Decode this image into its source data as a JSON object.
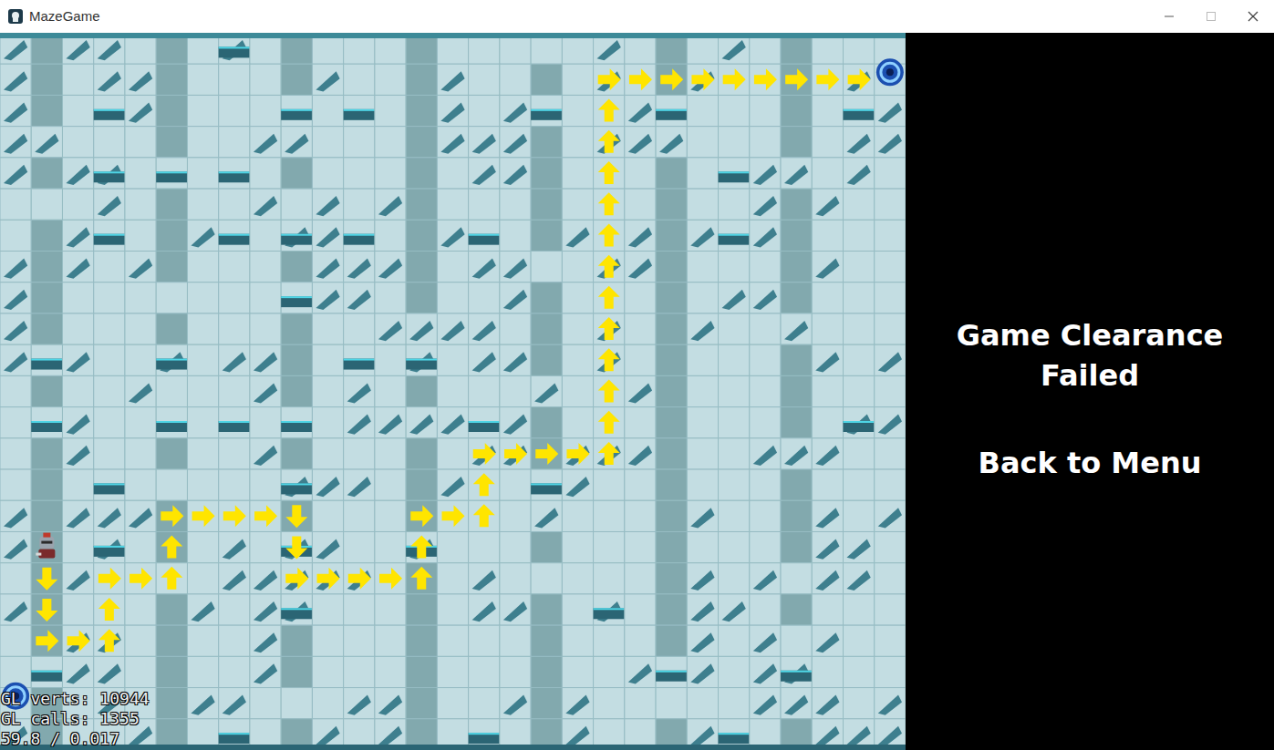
{
  "window": {
    "title": "MazeGame"
  },
  "panel": {
    "message": "Game Clearance Failed",
    "menu_button": "Back to Menu"
  },
  "stats": [
    "GL verts: 10944",
    "GL calls: 1355",
    "59.8 / 0.017"
  ],
  "path": [
    "down",
    "down",
    "right",
    "right",
    "up",
    "up",
    "right",
    "right",
    "up",
    "up",
    "right",
    "right",
    "right",
    "right",
    "down",
    "down",
    "right",
    "right",
    "right",
    "right",
    "up",
    "up",
    "right",
    "right",
    "up",
    "up",
    "right",
    "right",
    "right",
    "right",
    "up",
    "up",
    "up",
    "up",
    "up",
    "up",
    "up",
    "up",
    "up",
    "up",
    "up",
    "up",
    "right",
    "right",
    "right",
    "right",
    "right",
    "right",
    "right",
    "right",
    "right"
  ]
}
